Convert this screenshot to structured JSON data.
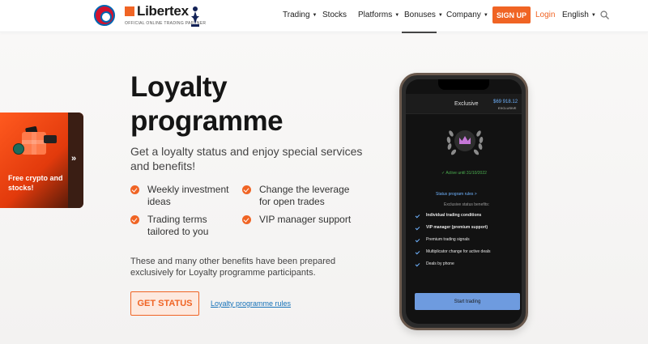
{
  "header": {
    "brand": "Libertex",
    "partner_line": "OFFICIAL ONLINE TRADING PARTNER",
    "nav": [
      {
        "label": "Trading",
        "has_dropdown": true
      },
      {
        "label": "Stocks",
        "has_dropdown": false
      },
      {
        "label": "Platforms",
        "has_dropdown": true
      },
      {
        "label": "Bonuses",
        "has_dropdown": true
      },
      {
        "label": "Company",
        "has_dropdown": true
      }
    ],
    "signup_label": "SIGN UP",
    "login_label": "Login",
    "language_label": "English",
    "icons": [
      "fc-bayern-logo",
      "libertex-logo",
      "tottenham-logo",
      "search-icon"
    ]
  },
  "promo": {
    "text": "Free crypto and stocks!",
    "arrow": "»"
  },
  "hero": {
    "title_line1": "Loyalty",
    "title_line2": "programme",
    "subtitle": "Get a loyalty status and enjoy special services and benefits!",
    "benefits": [
      "Weekly investment ideas",
      "Change the leverage for open trades",
      "Trading terms tailored to you",
      "VIP manager support"
    ],
    "note": "These and many other benefits have been prepared exclusively for Loyalty programme participants.",
    "cta_label": "GET STATUS",
    "rules_link": "Loyalty programme rules"
  },
  "phone": {
    "status_name": "Exclusive",
    "balance": "$69 918.12",
    "tier": "EXCLUSIVE",
    "active_until": "Active until 31/10/2022",
    "rules_link": "Status program rules >",
    "benefits_title": "Exclusive status benefits:",
    "items": [
      {
        "label": "Individual trading conditions",
        "bold": true
      },
      {
        "label": "VIP manager (premium support)",
        "bold": true
      },
      {
        "label": "Premium trading signals",
        "bold": false
      },
      {
        "label": "Multiplicator change for active deals",
        "bold": false
      },
      {
        "label": "Deals by phone",
        "bold": false
      }
    ],
    "button_label": "Start trading"
  },
  "colors": {
    "accent": "#f06424",
    "link": "#1672b8",
    "phone_accent": "#6fb3ff",
    "crown": "#c678d8"
  }
}
